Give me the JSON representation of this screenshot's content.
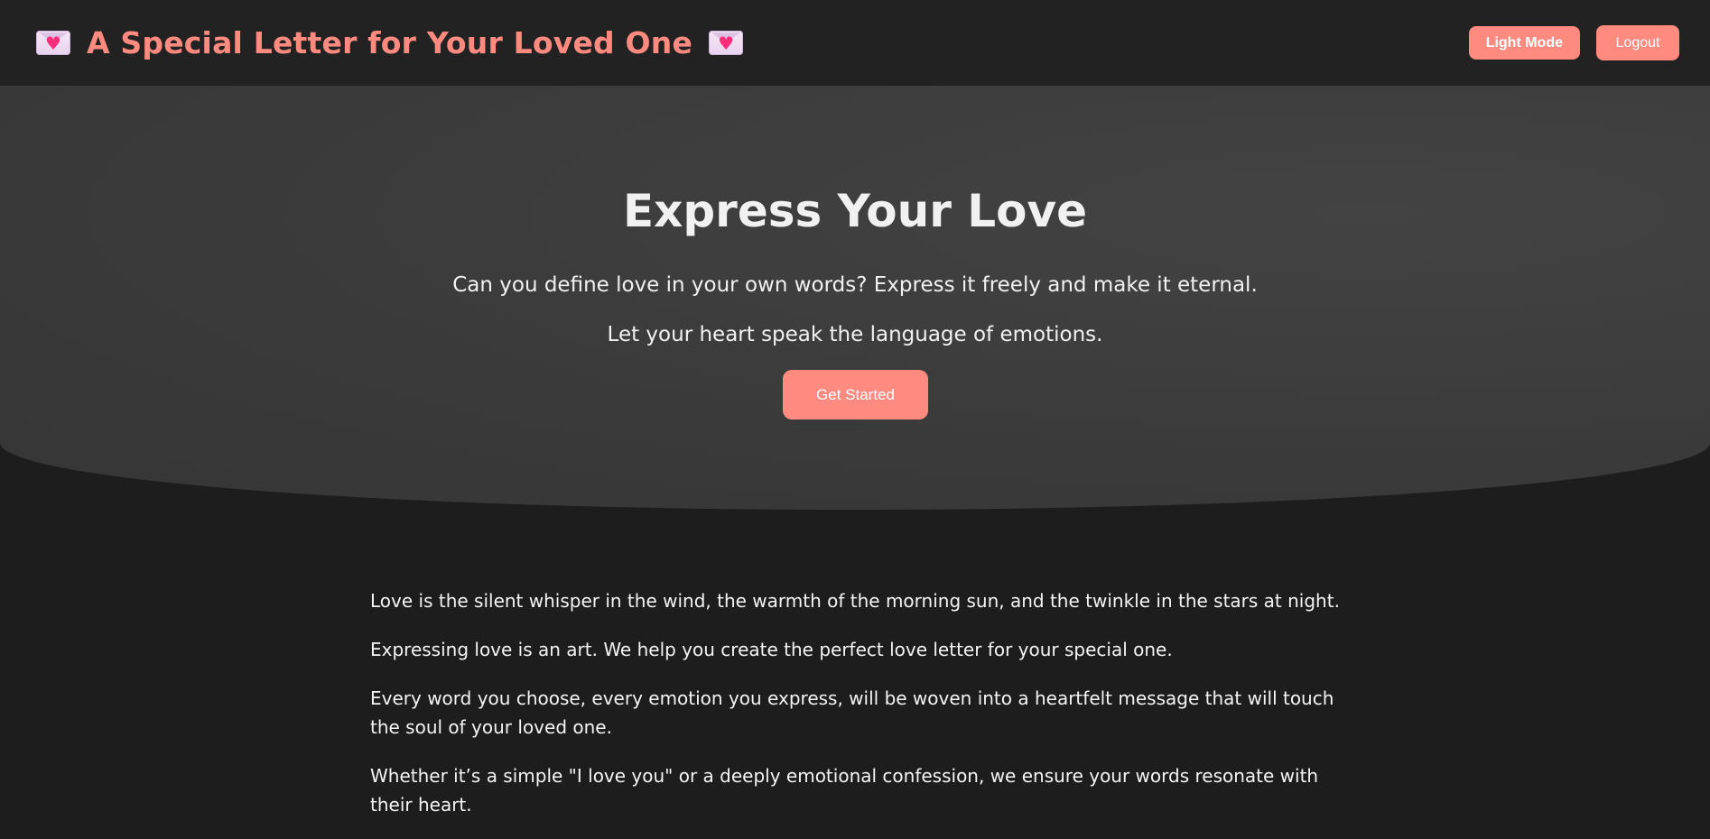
{
  "header": {
    "title": "A Special Letter for Your Loved One",
    "light_mode_label": "Light Mode",
    "logout_label": "Logout",
    "left_icon": "love-letter-icon",
    "right_icon": "love-letter-icon"
  },
  "hero": {
    "title": "Express Your Love",
    "line1": "Can you define love in your own words? Express it freely and make it eternal.",
    "line2": "Let your heart speak the language of emotions.",
    "cta_label": "Get Started"
  },
  "content": {
    "paragraphs": [
      "Love is the silent whisper in the wind, the warmth of the morning sun, and the twinkle in the stars at night.",
      "Expressing love is an art. We help you create the perfect love letter for your special one.",
      "Every word you choose, every emotion you express, will be woven into a heartfelt message that will touch the soul of your loved one.",
      "Whether it’s a simple \"I love you\" or a deeply emotional confession, we ensure your words resonate with their heart."
    ]
  },
  "colors": {
    "accent": "#ff8a80",
    "header_bg": "#222222",
    "hero_bg": "#3a3a3a",
    "page_bg": "#1d1d1d"
  }
}
